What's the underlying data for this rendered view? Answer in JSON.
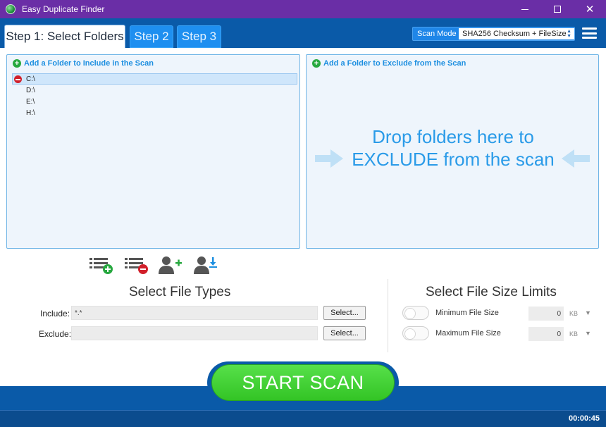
{
  "window": {
    "title": "Easy Duplicate Finder",
    "minimize": "",
    "maximize": "",
    "close": "✕"
  },
  "tabs": [
    {
      "label": "Step 1: Select Folders",
      "active": true
    },
    {
      "label": "Step 2",
      "active": false
    },
    {
      "label": "Step 3",
      "active": false
    }
  ],
  "scan_mode": {
    "label": "Scan Mode",
    "value": "SHA256 Checksum + FileSize"
  },
  "include_panel": {
    "title": "Add a Folder to Include in the Scan",
    "folders": [
      "C:\\",
      "D:\\",
      "E:\\",
      "H:\\"
    ],
    "selected_index": 0
  },
  "exclude_panel": {
    "title": "Add a Folder to Exclude from the Scan",
    "drop_text": "Drop folders here to EXCLUDE from the scan"
  },
  "toolbar_icons": [
    "add-folder-list-icon",
    "remove-folder-list-icon",
    "add-user-icon",
    "user-download-icon"
  ],
  "file_types": {
    "title": "Select File Types",
    "include_label": "Include:",
    "include_value": "*.*",
    "exclude_label": "Exclude:",
    "exclude_value": "",
    "select_button": "Select..."
  },
  "file_size": {
    "title": "Select File Size Limits",
    "min_label": "Minimum File Size",
    "min_value": "0",
    "max_label": "Maximum File Size",
    "max_value": "0",
    "unit": "KB"
  },
  "start_button": "START SCAN",
  "status": {
    "timer": "00:00:45"
  },
  "colors": {
    "titlebar": "#6a2ea6",
    "header": "#0a5aa8",
    "accent": "#1d8fe0",
    "start_green": "#3fd132"
  }
}
